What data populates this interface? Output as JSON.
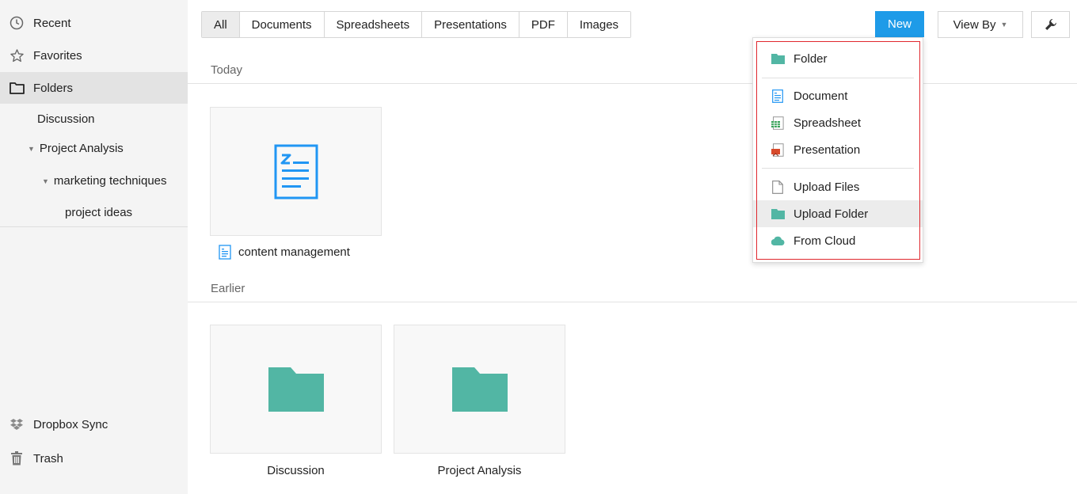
{
  "sidebar": {
    "nav": [
      {
        "label": "Recent",
        "icon": "clock-icon"
      },
      {
        "label": "Favorites",
        "icon": "star-icon"
      },
      {
        "label": "Folders",
        "icon": "folder-outline-icon"
      }
    ],
    "tree": [
      {
        "label": "Discussion"
      },
      {
        "label": "Project Analysis"
      },
      {
        "label": "marketing techniques"
      },
      {
        "label": "project ideas"
      }
    ],
    "bottom": [
      {
        "label": "Dropbox Sync",
        "icon": "dropbox-icon"
      },
      {
        "label": "Trash",
        "icon": "trash-icon"
      }
    ]
  },
  "filters": [
    "All",
    "Documents",
    "Spreadsheets",
    "Presentations",
    "PDF",
    "Images"
  ],
  "toolbar": {
    "new_label": "New",
    "viewby_label": "View By",
    "tools_icon": "wrench-icon"
  },
  "sections": {
    "today": "Today",
    "earlier": "Earlier"
  },
  "files": {
    "today": [
      {
        "name": "content management",
        "icon": "writer-document-icon"
      }
    ],
    "earlier": [
      {
        "name": "Discussion",
        "icon": "folder-icon"
      },
      {
        "name": "Project Analysis",
        "icon": "folder-icon"
      }
    ]
  },
  "new_menu": {
    "items": [
      {
        "label": "Folder",
        "icon": "folder-icon"
      },
      {
        "label": "Document",
        "icon": "document-icon"
      },
      {
        "label": "Spreadsheet",
        "icon": "spreadsheet-icon"
      },
      {
        "label": "Presentation",
        "icon": "presentation-icon"
      },
      {
        "label": "Upload Files",
        "icon": "file-icon"
      },
      {
        "label": "Upload Folder",
        "icon": "folder-upload-icon"
      },
      {
        "label": "From Cloud",
        "icon": "cloud-icon"
      }
    ]
  },
  "colors": {
    "accent": "#1e9be8",
    "folder": "#52b6a4",
    "document": "#2196f3",
    "highlight": "#e0282e"
  }
}
